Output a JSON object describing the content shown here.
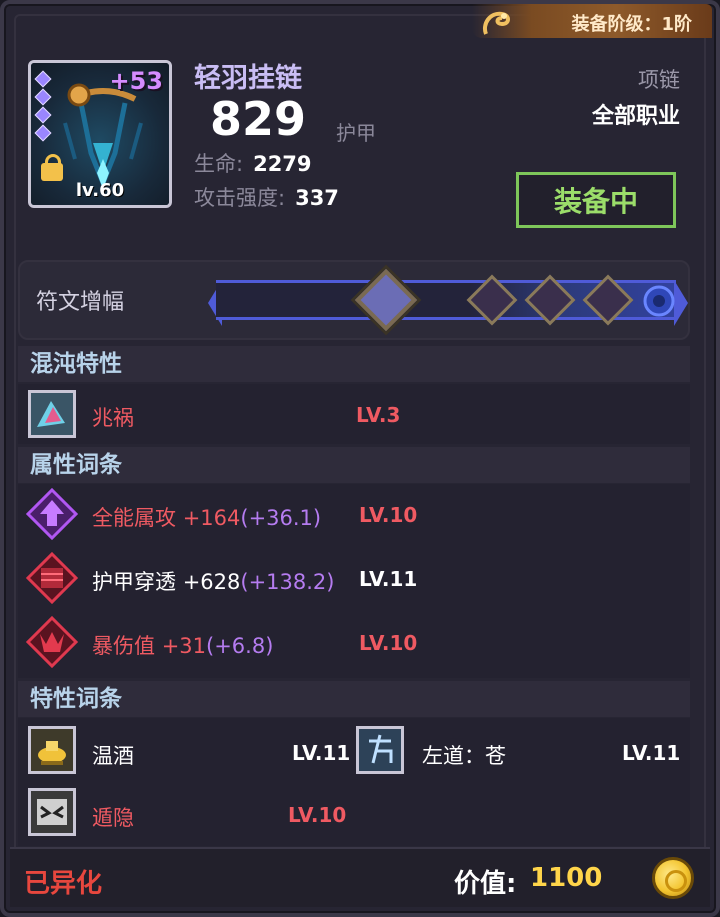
{
  "tier_badge": {
    "text": "装备阶级：1阶"
  },
  "item": {
    "name": "轻羽挂链",
    "enhance_level": "+53",
    "level_label": "lv.60",
    "armor_value": "829",
    "armor_label": "护甲",
    "stats": [
      {
        "label": "生命:",
        "value": "2279"
      },
      {
        "label": "攻击强度:",
        "value": "337"
      }
    ],
    "slot_type": "项链",
    "class_requirement": "全部职业",
    "equipped_label": "装备中"
  },
  "rune": {
    "label": "符文增幅",
    "colors": {
      "track": "#4f5bd8",
      "filled_gem": "#6b6db5"
    }
  },
  "chaos_traits": {
    "header": "混沌特性",
    "items": [
      {
        "name": "兆祸",
        "level": "LV.3",
        "icon": "chaos-trait-icon"
      }
    ]
  },
  "affixes": {
    "header": "属性词条",
    "items": [
      {
        "name": "全能属攻",
        "value": "+164",
        "bonus": "(+36.1)",
        "level": "LV.10",
        "level_color": "#ef5a62",
        "icon": "purple-arrow-icon"
      },
      {
        "name": "护甲穿透",
        "value": "+628",
        "bonus": "(+138.2)",
        "level": "LV.11",
        "level_color": "#ffffff",
        "icon": "red-armor-icon"
      },
      {
        "name": "暴伤值",
        "value": "+31",
        "bonus": "(+6.8)",
        "level": "LV.10",
        "level_color": "#ef5a62",
        "icon": "red-crit-icon"
      }
    ]
  },
  "perks": {
    "header": "特性词条",
    "items": [
      {
        "name": "温酒",
        "level": "LV.11",
        "color": "#ffffff",
        "icon": "wine-pot-icon"
      },
      {
        "name": "左道：苍",
        "level": "LV.11",
        "color": "#ffffff",
        "icon": "left-path-icon"
      },
      {
        "name": "遁隐",
        "level": "LV.10",
        "color": "#ef5a62",
        "icon": "hidden-icon"
      }
    ]
  },
  "footer": {
    "status": "已异化",
    "value_label": "价值:",
    "value": "1100"
  }
}
